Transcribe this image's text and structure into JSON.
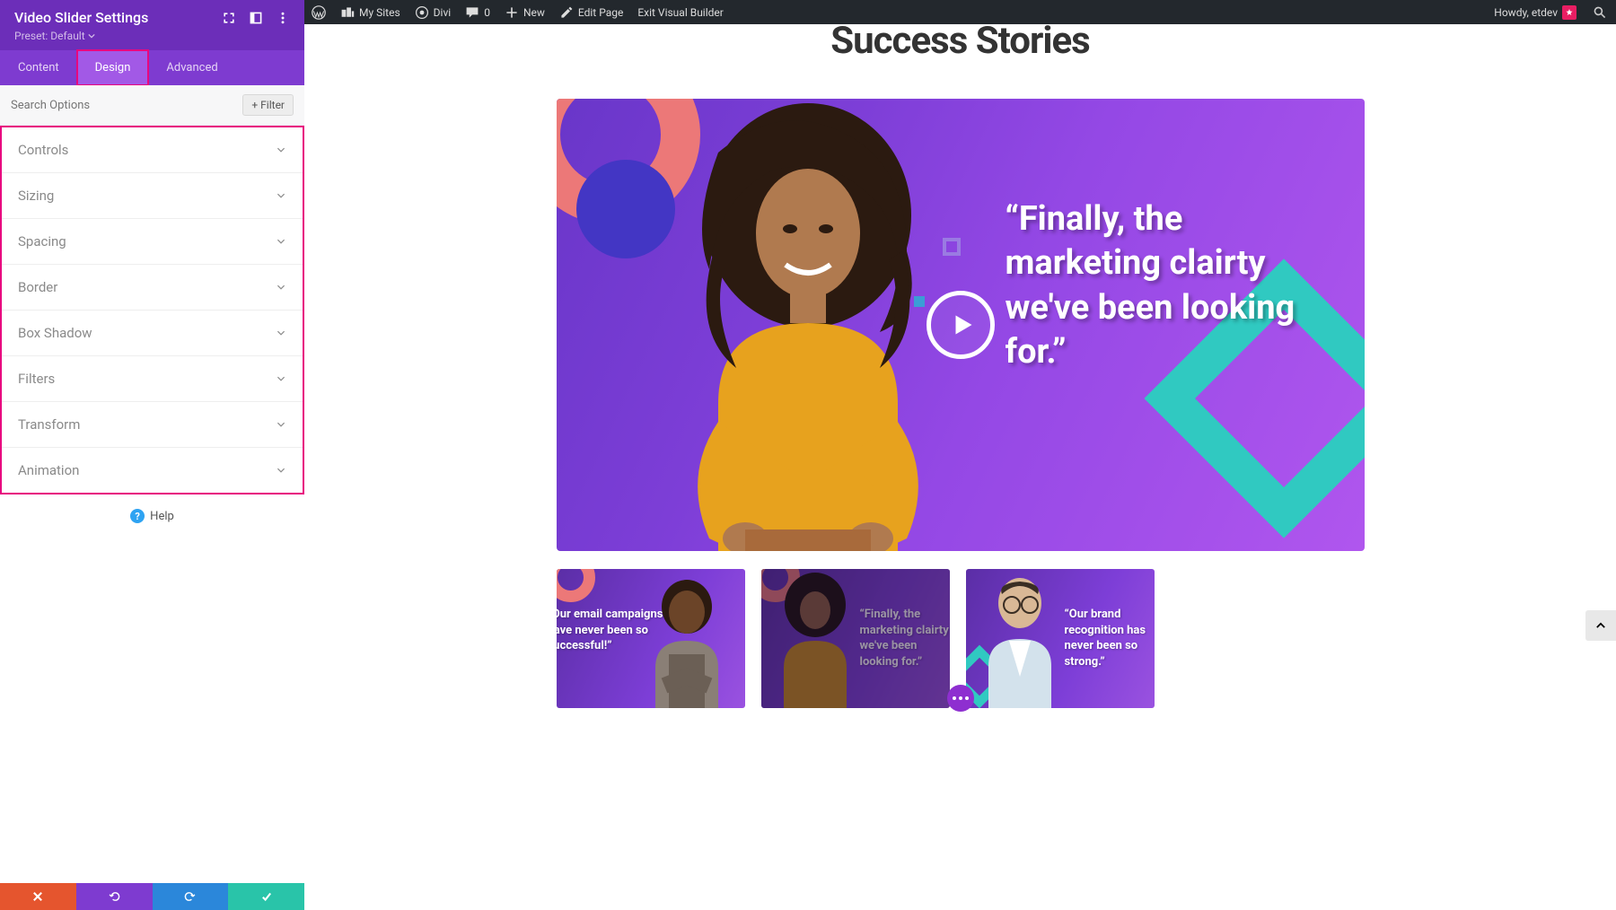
{
  "wp_bar": {
    "left": [
      {
        "icon": "wp-logo",
        "label": ""
      },
      {
        "icon": "sites",
        "label": "My Sites"
      },
      {
        "icon": "divi",
        "label": "Divi"
      },
      {
        "icon": "comment",
        "label": "0"
      },
      {
        "icon": "plus",
        "label": "New"
      },
      {
        "icon": "pencil",
        "label": "Edit Page"
      },
      {
        "icon": "",
        "label": "Exit Visual Builder"
      }
    ],
    "greeting": "Howdy, etdev"
  },
  "panel": {
    "title": "Video Slider Settings",
    "preset": "Preset: Default",
    "tabs": [
      {
        "key": "content",
        "label": "Content",
        "active": false
      },
      {
        "key": "design",
        "label": "Design",
        "active": true
      },
      {
        "key": "advanced",
        "label": "Advanced",
        "active": false
      }
    ],
    "search_placeholder": "Search Options",
    "filter_label": "Filter",
    "accordion": [
      "Controls",
      "Sizing",
      "Spacing",
      "Border",
      "Box Shadow",
      "Filters",
      "Transform",
      "Animation"
    ],
    "help_label": "Help"
  },
  "page": {
    "heading": "Success Stories",
    "main_quote": "“Finally, the marketing clairty we've been looking for.”",
    "thumbs": [
      {
        "quote": "“Our email campaigns have never been so successful!”",
        "dark": false,
        "person": "man1",
        "text_side": "left"
      },
      {
        "quote": "“Finally, the marketing clairty we've been looking for.”",
        "dark": true,
        "person": "woman1",
        "text_side": "right"
      },
      {
        "quote": "“Our brand recognition has never been so strong.”",
        "dark": false,
        "person": "man2",
        "text_side": "right"
      }
    ]
  }
}
